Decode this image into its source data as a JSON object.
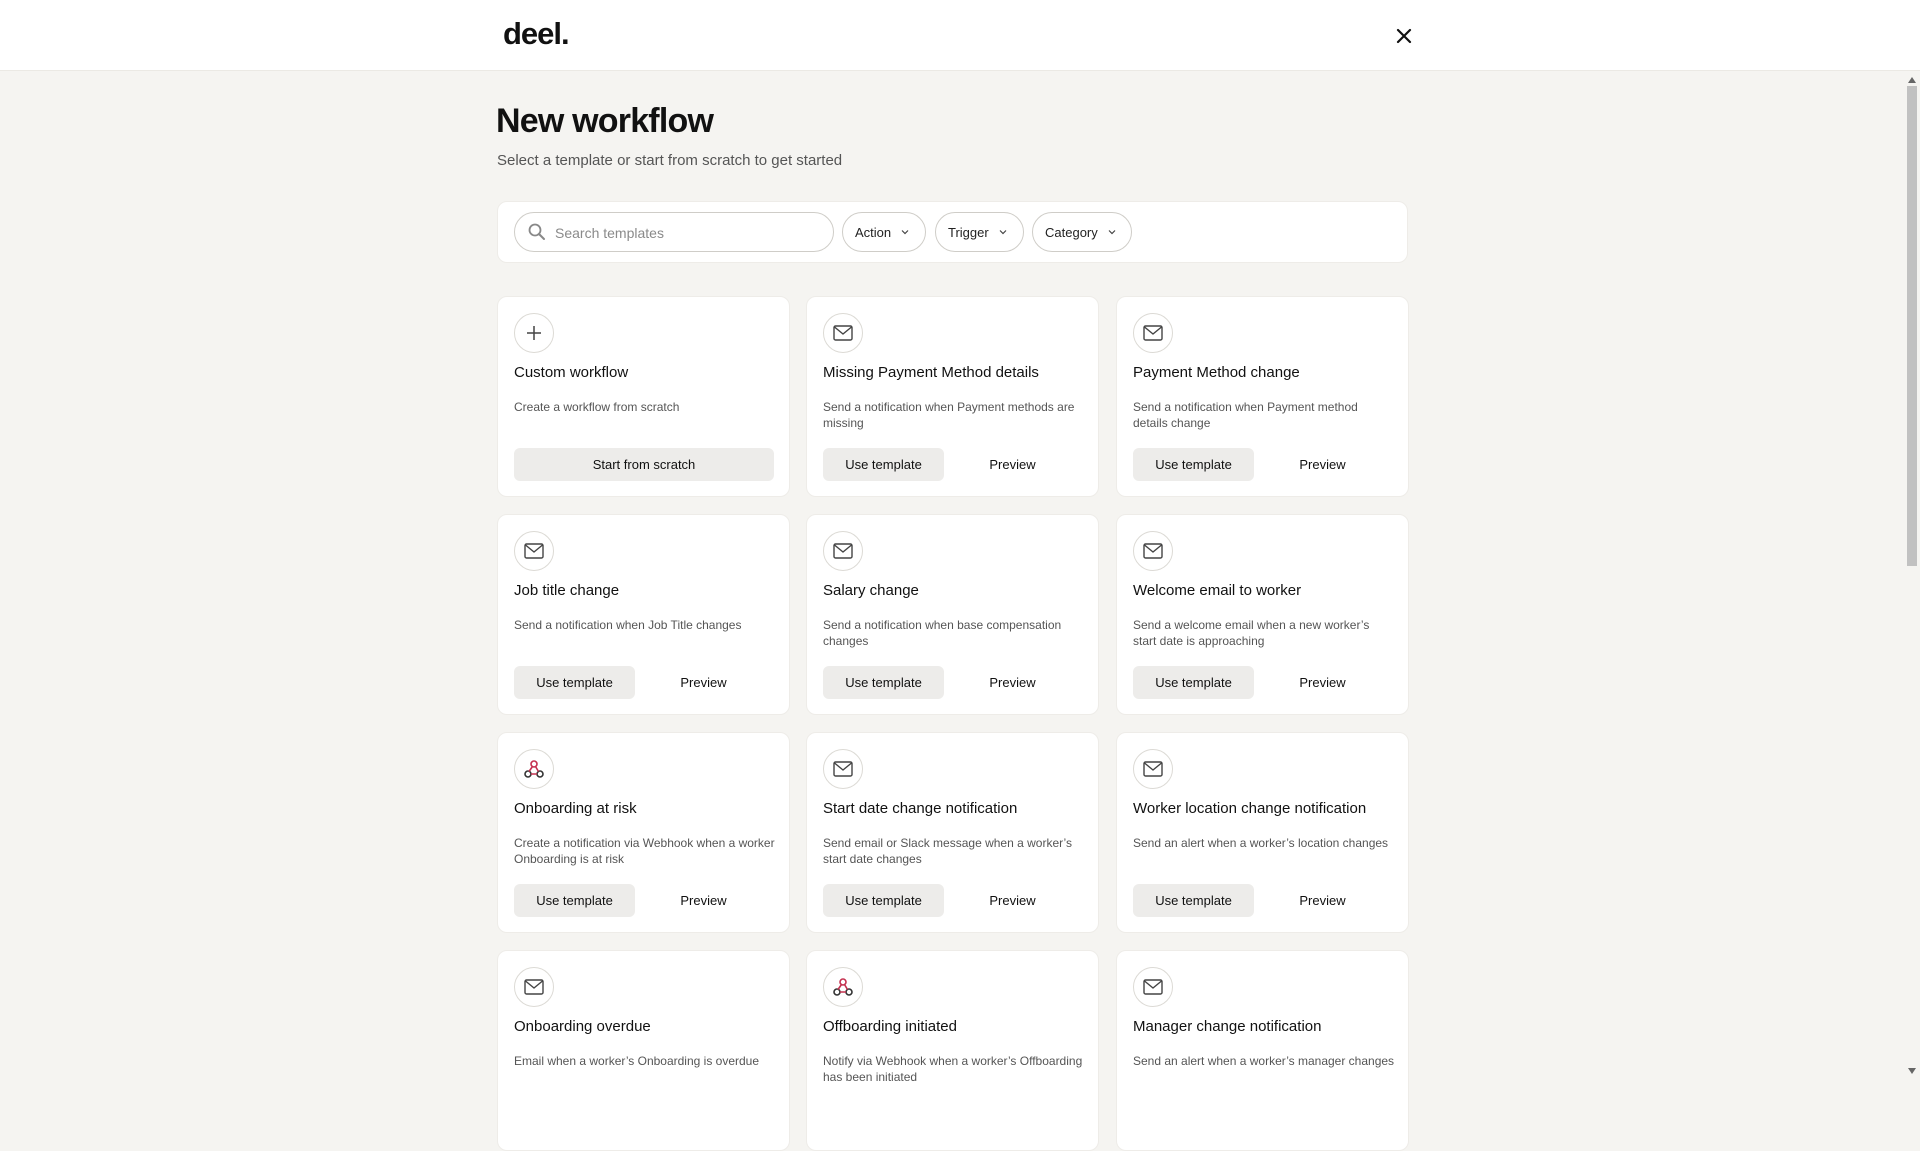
{
  "header": {
    "logo": "deel.",
    "close_icon": "close-icon"
  },
  "page": {
    "title": "New workflow",
    "subtitle": "Select a template or start from scratch to get started"
  },
  "filters": {
    "search_placeholder": "Search templates",
    "search_value": "",
    "action_label": "Action",
    "trigger_label": "Trigger",
    "category_label": "Category"
  },
  "buttons": {
    "use_template": "Use template",
    "preview": "Preview",
    "start_from_scratch": "Start from scratch"
  },
  "cards": [
    {
      "icon": "plus-icon",
      "title": "Custom workflow",
      "desc": "Create a workflow from scratch"
    },
    {
      "icon": "mail-icon",
      "title": "Missing Payment Method details",
      "desc": "Send a notification when Payment methods are missing"
    },
    {
      "icon": "mail-icon",
      "title": "Payment Method change",
      "desc": "Send a notification when Payment method details change"
    },
    {
      "icon": "mail-icon",
      "title": "Job title change",
      "desc": "Send a notification when Job Title changes"
    },
    {
      "icon": "mail-icon",
      "title": "Salary change",
      "desc": "Send a notification when base compensation changes"
    },
    {
      "icon": "mail-icon",
      "title": "Welcome email to worker",
      "desc": "Send a welcome email when a new worker’s start date is approaching"
    },
    {
      "icon": "webhook-icon",
      "title": "Onboarding at risk",
      "desc": "Create a notification via Webhook when a worker Onboarding is at risk"
    },
    {
      "icon": "mail-icon",
      "title": "Start date change notification",
      "desc": "Send email or Slack message when a worker’s start date changes"
    },
    {
      "icon": "mail-icon",
      "title": "Worker location change notification",
      "desc": "Send an alert when a worker’s location changes"
    },
    {
      "icon": "mail-icon",
      "title": "Onboarding overdue",
      "desc": "Email when a worker’s Onboarding is overdue"
    },
    {
      "icon": "webhook-icon",
      "title": "Offboarding initiated",
      "desc": "Notify via Webhook when a worker’s Offboarding has been initiated"
    },
    {
      "icon": "mail-icon",
      "title": "Manager change notification",
      "desc": "Send an alert when a worker’s manager changes"
    }
  ],
  "colors": {
    "background": "#f5f4f1",
    "webhook_accent": "#c4304f"
  }
}
